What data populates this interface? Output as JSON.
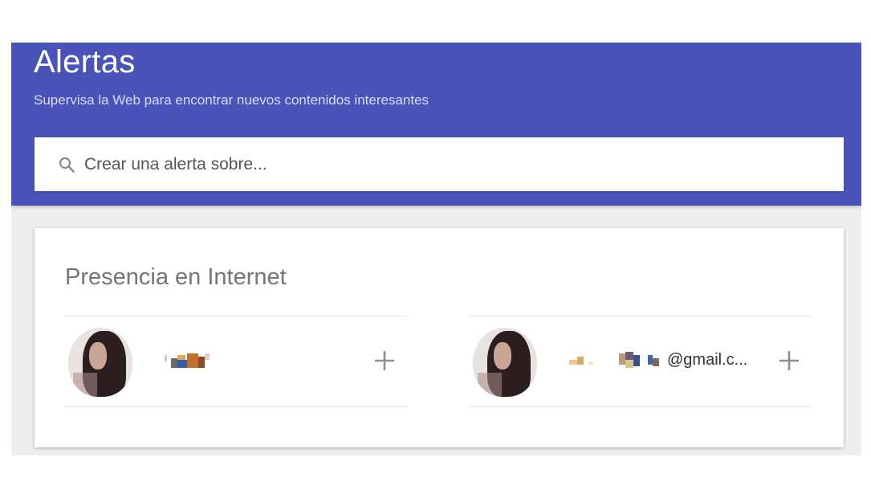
{
  "header": {
    "title": "Alertas",
    "subtitle": "Supervisa la Web para encontrar nuevos contenidos interesantes",
    "background_color": "#4a53b8"
  },
  "search": {
    "icon": "search-icon",
    "placeholder": "Crear una alerta sobre..."
  },
  "presence": {
    "section_title": "Presencia en Internet",
    "accounts": [
      {
        "avatar": "profile-photo",
        "label": "",
        "add_icon": "plus-icon"
      },
      {
        "avatar": "profile-photo",
        "label": "@gmail.c...",
        "add_icon": "plus-icon"
      }
    ]
  }
}
